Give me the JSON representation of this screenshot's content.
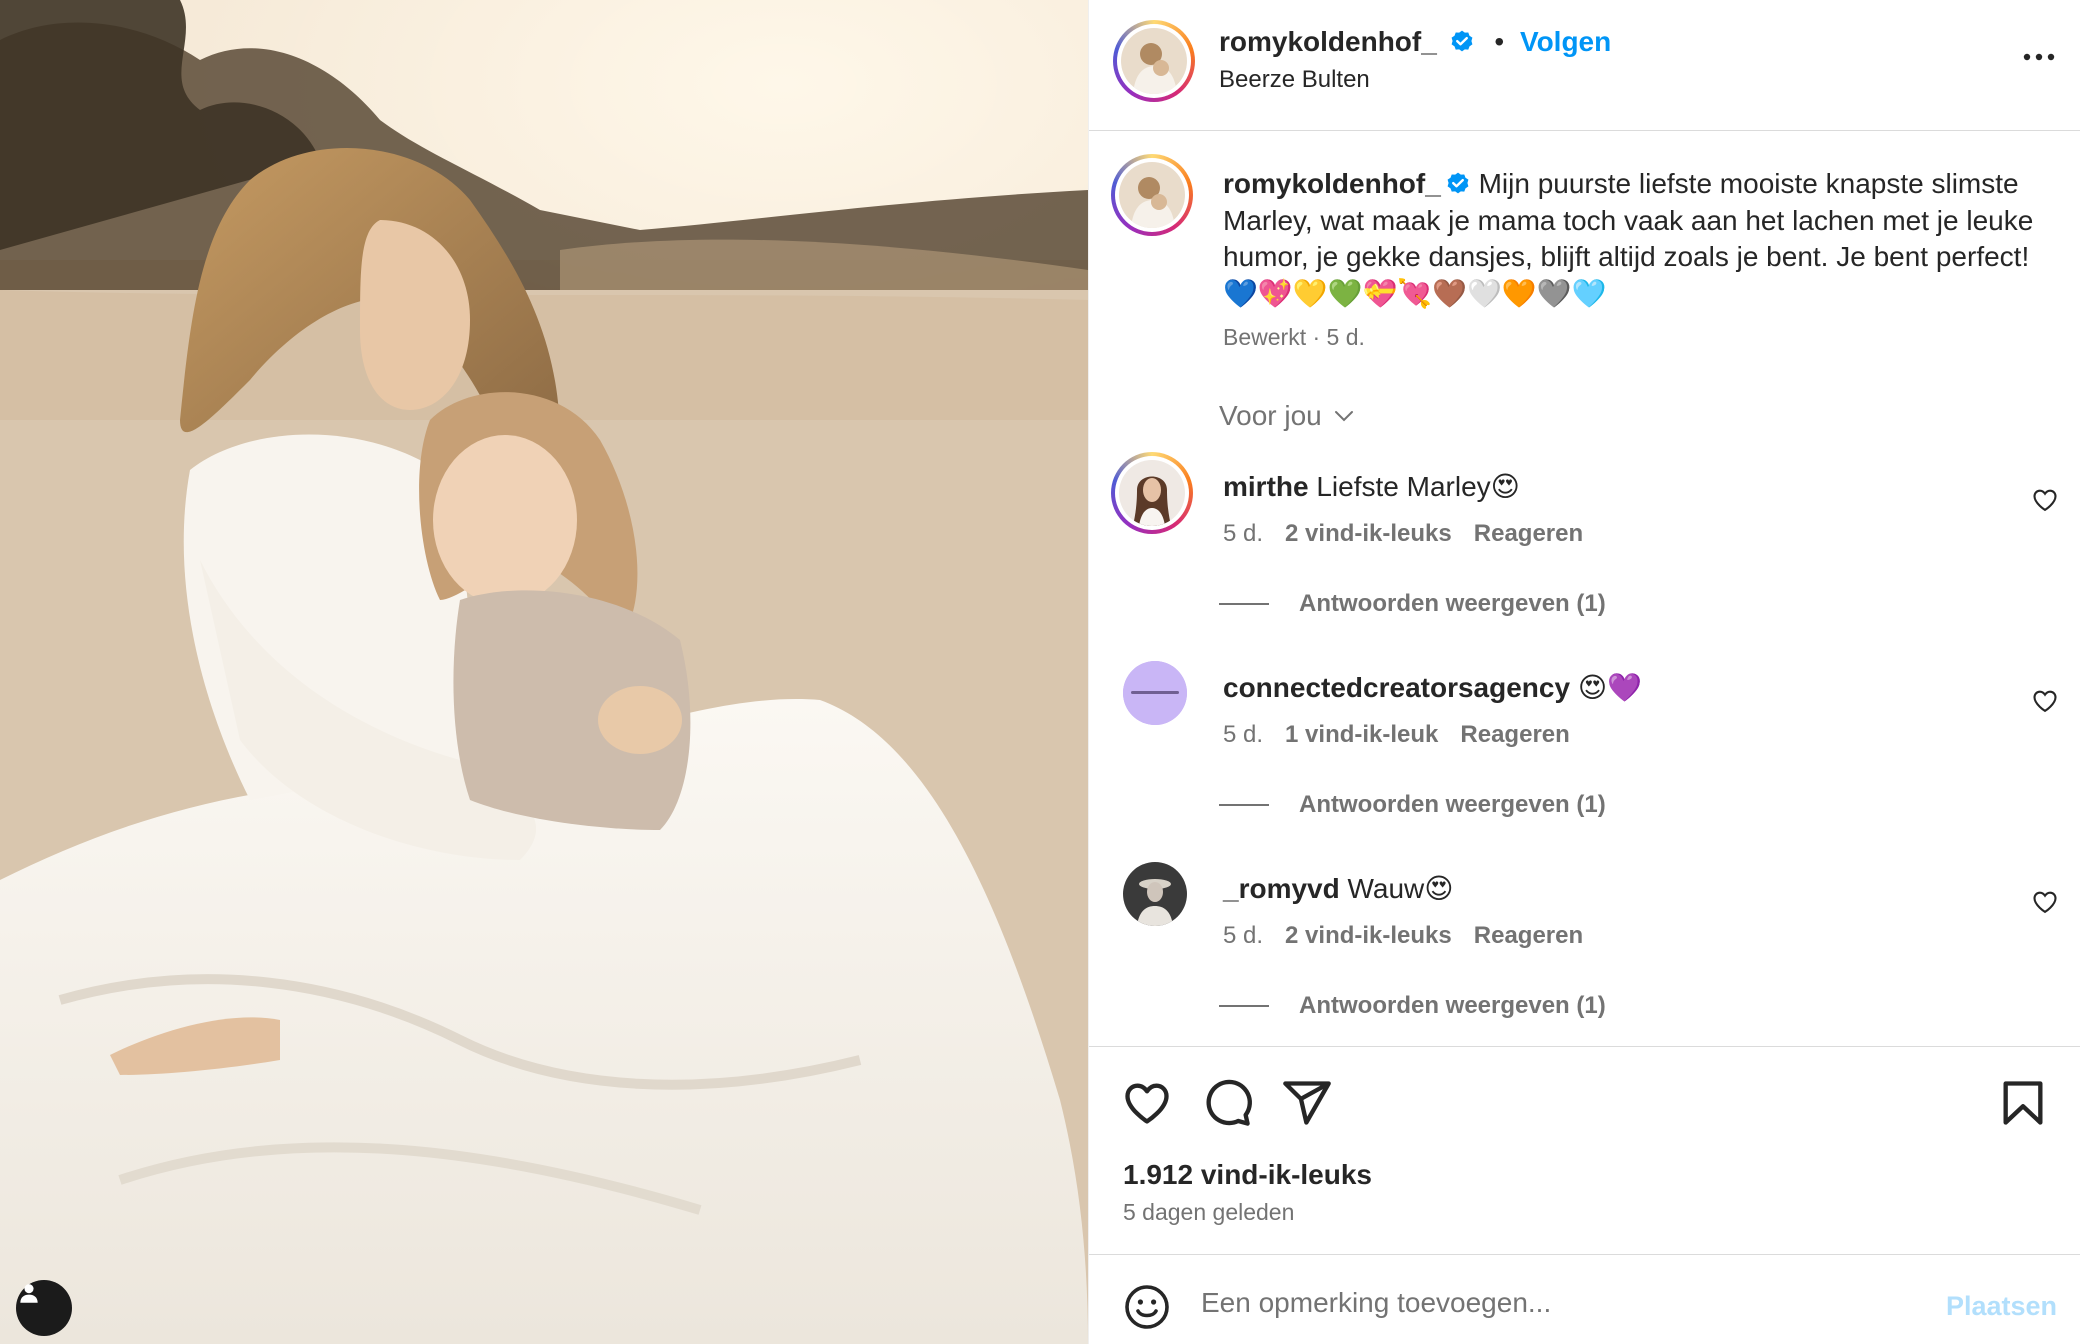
{
  "post": {
    "username": "romykoldenhof_",
    "follow_label": "Volgen",
    "separator": "•",
    "location": "Beerze Bulten"
  },
  "caption": {
    "username": "romykoldenhof_",
    "text": "Mijn puurste liefste mooiste knapste slimste Marley, wat maak je mama toch vaak aan het lachen met je leuke humor, je gekke dansjes, blijft altijd zoals je bent. Je bent perfect!💙💖💛💚💝💘🤎🤍🧡🩶🩵",
    "meta": "Bewerkt · 5 d."
  },
  "filter_label": "Voor jou",
  "comments": [
    {
      "username": "mirthe",
      "text": "Liefste Marley😍",
      "age": "5 d.",
      "likes": "2 vind-ik-leuks",
      "reply_label": "Reageren",
      "view_replies": "Antwoorden weergeven (1)"
    },
    {
      "username": "connectedcreatorsagency",
      "text": "😍💜",
      "age": "5 d.",
      "likes": "1 vind-ik-leuk",
      "reply_label": "Reageren",
      "view_replies": "Antwoorden weergeven (1)"
    },
    {
      "username": "_romyvd",
      "text": "Wauw😍",
      "age": "5 d.",
      "likes": "2 vind-ik-leuks",
      "reply_label": "Reageren",
      "view_replies": "Antwoorden weergeven (1)"
    }
  ],
  "stats": {
    "likes": "1.912 vind-ik-leuks",
    "posted": "5 dagen geleden"
  },
  "add_comment": {
    "placeholder": "Een opmerking toevoegen...",
    "post_label": "Plaatsen"
  },
  "colors": {
    "link": "#0095f6",
    "muted": "#737373",
    "post_disabled": "#b2dffc"
  },
  "icons": [
    "user-tag-icon",
    "verified-badge-icon",
    "more-options-icon",
    "chevron-down-icon",
    "heart-icon",
    "comment-icon",
    "share-icon",
    "bookmark-icon",
    "emoji-icon"
  ]
}
